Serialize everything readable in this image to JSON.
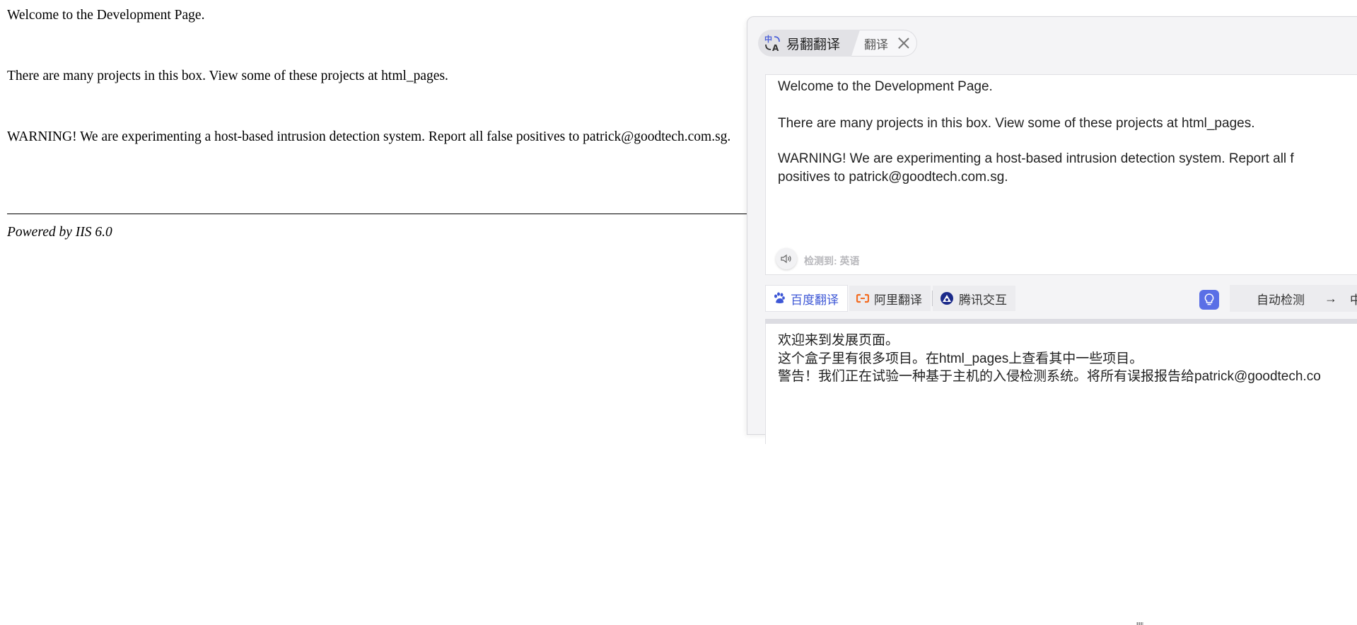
{
  "webpage": {
    "welcome": "Welcome to the Development Page.",
    "projects": "There are many projects in this box. View some of these projects at html_pages.",
    "warning": "WARNING! We are experimenting a host-based intrusion detection system. Report all false positives to patrick@goodtech.com.sg.",
    "footer": "Powered by IIS 6.0"
  },
  "translator": {
    "tabs": [
      {
        "label": "易翻翻译",
        "icon": "translate-logo-icon"
      },
      {
        "label": "翻译",
        "icon": "close-icon"
      }
    ],
    "source_lines": [
      "Welcome to the Development Page.",
      "There are many projects in this box. View some of these projects at html_pages.",
      "WARNING! We are experimenting a host-based intrusion detection system. Report all f",
      "positives to patrick@goodtech.com.sg."
    ],
    "detected_language": "检测到: 英语",
    "engines": [
      {
        "label": "百度翻译",
        "icon": "baidu-icon",
        "active": true
      },
      {
        "label": "阿里翻译",
        "icon": "aliyun-icon",
        "active": false
      },
      {
        "label": "腾讯交互",
        "icon": "tencent-icon",
        "active": false
      }
    ],
    "language_from": "自动检测",
    "language_arrow": "→",
    "language_to": "中",
    "target_lines": [
      "欢迎来到发展页面。",
      "这个盒子里有很多项目。在html_pages上查看其中一些项目。",
      "警告！我们正在试验一种基于主机的入侵检测系统。将所有误报报告给patrick@goodtech.co"
    ],
    "colors": {
      "accent": "#3d57d6",
      "hint_button": "#5a6fe6",
      "aliyun": "#f36c21"
    }
  }
}
